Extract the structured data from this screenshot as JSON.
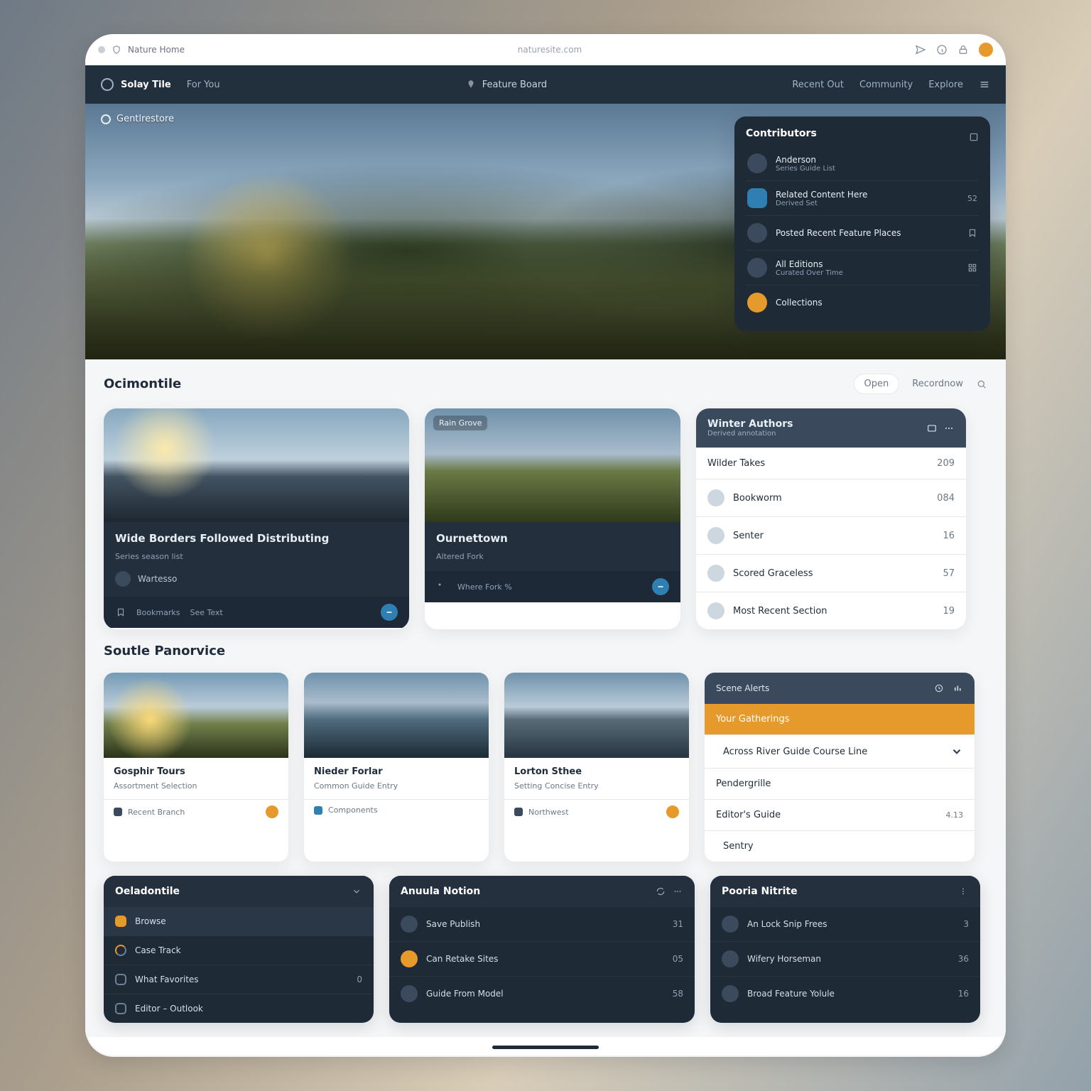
{
  "chrome": {
    "tab_label": "Nature Home",
    "url_label": "naturesite.com"
  },
  "nav": {
    "brand": "Solay Tile",
    "link1": "For You",
    "mid": "Feature Board",
    "right1": "Recent Out",
    "right2": "Community",
    "right3": "Explore"
  },
  "hero": {
    "crumb": "Gentlrestore",
    "panel_title": "Contributors",
    "items": [
      {
        "t": "Anderson",
        "s": "Series Guide List",
        "m": ""
      },
      {
        "t": "Related Content Here",
        "s": "Derived Set",
        "m": "52"
      },
      {
        "t": "Posted Recent Feature Places",
        "s": "",
        "m": ""
      },
      {
        "t": "All Editions",
        "s": "Curated Over Time",
        "m": ""
      },
      {
        "t": "Collections",
        "s": "",
        "m": ""
      }
    ]
  },
  "section1": {
    "title": "Ocimontile",
    "filter_btn": "Open",
    "sort_label": "Recordnow"
  },
  "card_a": {
    "title": "Wide Borders Followed Distributing",
    "sub": "Series season list",
    "author": "Wartesso",
    "foot1": "Bookmarks",
    "foot2": "See Text"
  },
  "card_b": {
    "chip": "Rain Grove",
    "title": "Ournettown",
    "sub": "Altered Fork",
    "foot": "Where Fork %"
  },
  "list_head": {
    "title": "Winter Authors",
    "sub": "Derived annotation"
  },
  "list": [
    {
      "t": "Wilder Takes",
      "v": "209"
    },
    {
      "t": "Bookworm",
      "v": "084"
    },
    {
      "t": "Senter",
      "v": "16"
    },
    {
      "t": "Scored Graceless",
      "v": "57"
    },
    {
      "t": "Most Recent Section",
      "v": "19"
    }
  ],
  "section2": {
    "title": "Soutle Panorvice"
  },
  "mini": [
    {
      "t": "Gosphir Tours",
      "s": "Assortment Selection",
      "f": "Recent Branch"
    },
    {
      "t": "Nieder Forlar",
      "s": "Common Guide Entry",
      "f": "Components"
    },
    {
      "t": "Lorton Sthee",
      "s": "Setting Concise Entry",
      "f": "Northwest"
    }
  ],
  "stack": {
    "head": "Scene Alerts",
    "gold": "Your Gatherings",
    "row1": {
      "t": "Across River Guide Course Line"
    },
    "row2": {
      "t": "Pendergrille",
      "v": ""
    },
    "row3": {
      "t": "Editor's Guide",
      "v": "4.13"
    },
    "row4": {
      "t": "Sentry",
      "v": ""
    }
  },
  "dp": [
    {
      "title": "Oeladontile",
      "rows": [
        {
          "t": "Browse",
          "v": ""
        },
        {
          "t": "Case Track",
          "v": ""
        },
        {
          "t": "What Favorites",
          "v": "0"
        },
        {
          "t": "Editor – Outlook",
          "v": ""
        }
      ]
    },
    {
      "title": "Anuula Notion",
      "rows": [
        {
          "t": "Save Publish",
          "v": "31"
        },
        {
          "t": "Can Retake Sites",
          "v": "05"
        },
        {
          "t": "Guide From Model",
          "v": "58"
        }
      ]
    },
    {
      "title": "Pooria Nitrite",
      "rows": [
        {
          "t": "An Lock Snip Frees",
          "v": "3"
        },
        {
          "t": "Wifery Horseman",
          "v": "36"
        },
        {
          "t": "Broad Feature Yolule",
          "v": "16"
        }
      ]
    }
  ]
}
